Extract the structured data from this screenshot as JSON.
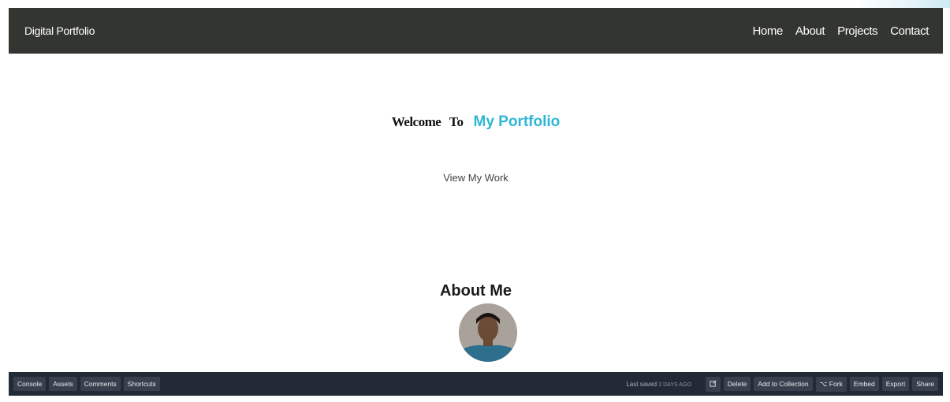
{
  "navbar": {
    "brand": "Digital Portfolio",
    "links": [
      "Home",
      "About",
      "Projects",
      "Contact"
    ]
  },
  "hero": {
    "welcome": "Welcome",
    "to": "To",
    "highlight": "My Portfolio",
    "cta": "View My Work"
  },
  "about": {
    "heading": "About Me"
  },
  "editor_bar": {
    "left": [
      "Console",
      "Assets",
      "Comments",
      "Shortcuts"
    ],
    "saved_label": "Last saved",
    "saved_ago": "2 DAYS AGO",
    "edit_icon": "edit-icon",
    "right": [
      "Delete",
      "Add to Collection",
      "⌥ Fork",
      "Embed",
      "Export",
      "Share"
    ]
  },
  "colors": {
    "navbar": "#333531",
    "accent": "#2fb5d6",
    "editor_bar": "#222a36"
  }
}
